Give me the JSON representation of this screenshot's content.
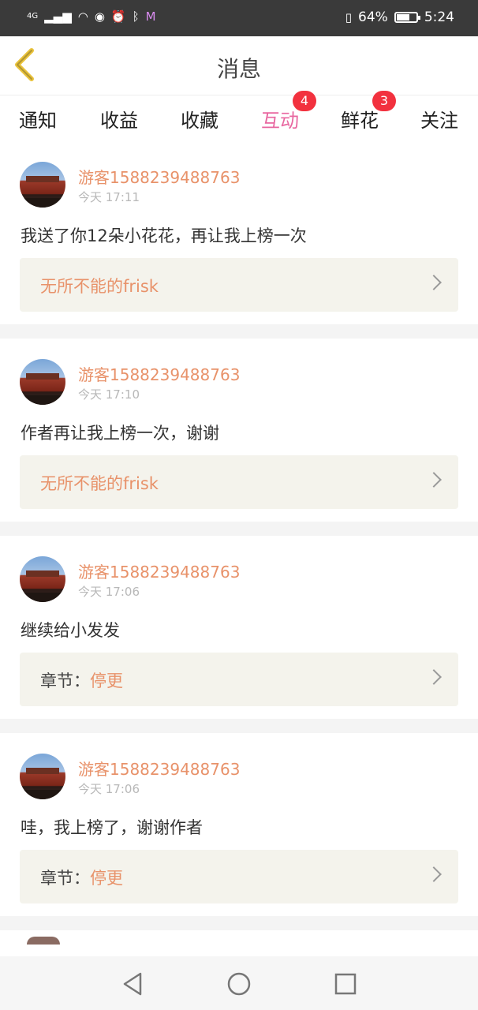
{
  "status_bar": {
    "network": "4G",
    "battery_percent": "64%",
    "battery_level": 0.64,
    "time": "5:24",
    "icons": [
      "signal-icon",
      "wifi-icon",
      "eye-icon",
      "alarm-icon",
      "bluetooth-icon",
      "app-icon",
      "vibrate-icon",
      "battery-icon"
    ]
  },
  "header": {
    "title": "消息",
    "back_icon": "chevron-left-icon"
  },
  "tabs": [
    {
      "label": "通知"
    },
    {
      "label": "收益"
    },
    {
      "label": "收藏"
    },
    {
      "label": "互动",
      "badge": "4",
      "active": true
    },
    {
      "label": "鲜花",
      "badge": "3"
    },
    {
      "label": "关注"
    }
  ],
  "messages": [
    {
      "user": "游客1588239488763",
      "time": "今天 17:11",
      "text": "我送了你12朵小花花，再让我上榜一次",
      "link_label": "",
      "link_value": "无所不能的frisk"
    },
    {
      "user": "游客1588239488763",
      "time": "今天 17:10",
      "text": "作者再让我上榜一次，谢谢",
      "link_label": "",
      "link_value": "无所不能的frisk"
    },
    {
      "user": "游客1588239488763",
      "time": "今天 17:06",
      "text": "继续给小发发",
      "link_label": "章节：",
      "link_value": "停更"
    },
    {
      "user": "游客1588239488763",
      "time": "今天 17:06",
      "text": "哇，我上榜了，谢谢作者",
      "link_label": "章节：",
      "link_value": "停更"
    }
  ],
  "colors": {
    "accent": "#e867a0",
    "username": "#e8926a",
    "badge": "#f2313e",
    "back_arrow": "#e9c23a"
  },
  "nav": [
    "back-triangle-icon",
    "home-circle-icon",
    "recents-square-icon"
  ]
}
